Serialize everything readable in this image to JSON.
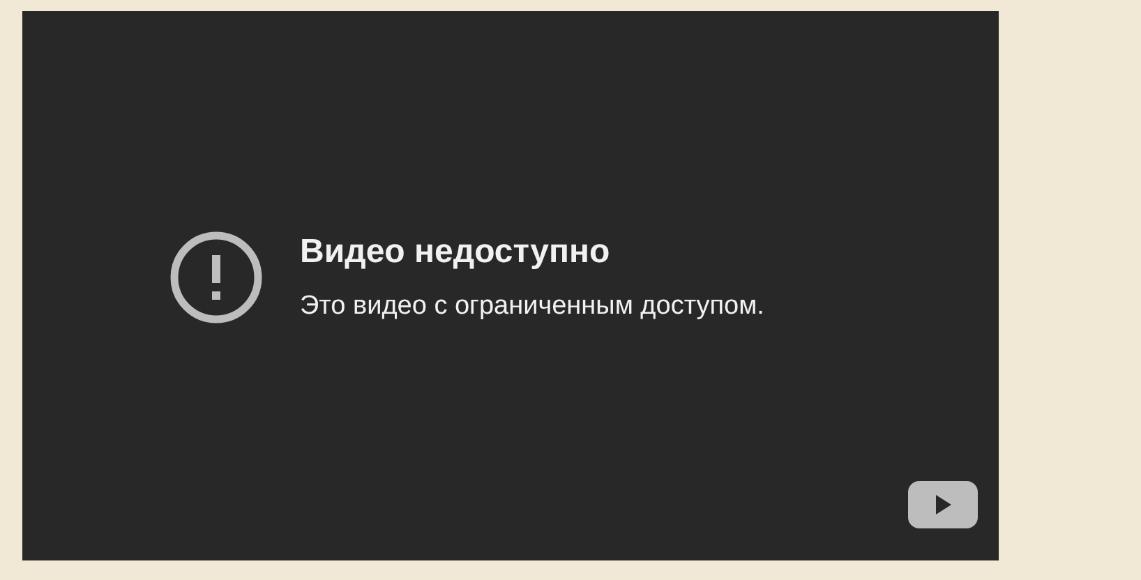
{
  "player": {
    "title": "Видео недоступно",
    "message": "Это видео с ограниченным доступом."
  }
}
